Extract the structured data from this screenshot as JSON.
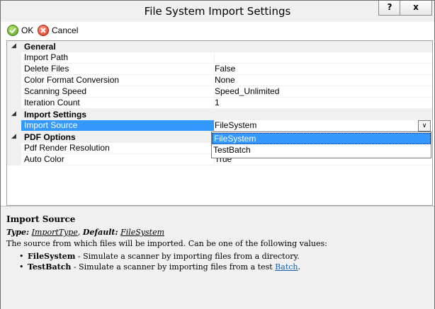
{
  "window": {
    "title": "File System Import Settings",
    "help_label": "?",
    "close_label": "x"
  },
  "toolbar": {
    "ok_label": "OK",
    "cancel_label": "Cancel"
  },
  "grid": {
    "categories": [
      {
        "label": "General"
      },
      {
        "label": "Import Settings"
      },
      {
        "label": "PDF Options"
      }
    ],
    "rows": [
      {
        "name": "Import Path",
        "value": ""
      },
      {
        "name": "Delete Files",
        "value": "False"
      },
      {
        "name": "Color Format Conversion",
        "value": "None"
      },
      {
        "name": "Scanning Speed",
        "value": "Speed_Unlimited"
      },
      {
        "name": "Iteration Count",
        "value": "1"
      },
      {
        "name": "Import Source",
        "value": "FileSystem"
      },
      {
        "name": "Pdf Render Resolution",
        "value": ""
      },
      {
        "name": "Auto Color",
        "value": "True"
      }
    ],
    "dropdown_options": [
      "FileSystem",
      "TestBatch"
    ],
    "selected_option": "FileSystem"
  },
  "description": {
    "title": "Import Source",
    "type_prefix": "Type:",
    "type_value": "ImportType",
    "default_prefix": "Default:",
    "default_value": "FileSystem",
    "text": "The source from which files will be imported. Can be one of the following values:",
    "bullets": [
      {
        "term": "FileSystem",
        "text": " - Simulate a scanner by importing files from a directory."
      },
      {
        "term": "TestBatch",
        "text": " - Simulate a scanner by importing files from a test ",
        "link": "Batch",
        "tail": "."
      }
    ]
  },
  "colors": {
    "selection": "#3399ff",
    "link": "#1a5eb0",
    "panel": "#f0f0f0"
  }
}
